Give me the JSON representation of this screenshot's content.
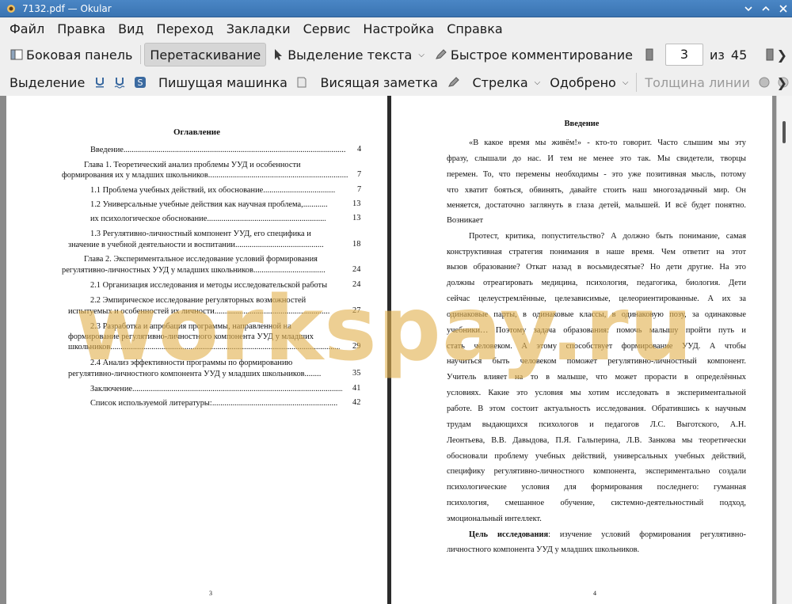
{
  "window": {
    "title": "7132.pdf  — Okular"
  },
  "menu": [
    "Файл",
    "Правка",
    "Вид",
    "Переход",
    "Закладки",
    "Сервис",
    "Настройка",
    "Справка"
  ],
  "toolbar1": {
    "sidebar": "Боковая панель",
    "drag": "Перетаскивание",
    "text_select": "Выделение текста",
    "quick_comment": "Быстрое комментирование",
    "page_current": "3",
    "page_of": "из",
    "page_total": "45"
  },
  "toolbar2": {
    "highlight": "Выделение",
    "typewriter": "Пишущая машинка",
    "pop_note": "Висящая заметка",
    "arrow": "Стрелка",
    "approved": "Одобрено",
    "line_width": "Толщина линии"
  },
  "left_page": {
    "title": "Оглавление",
    "toc": [
      {
        "text": "Введение",
        "page": "4"
      },
      {
        "text": "Глава 1. Теоретический анализ проблемы УУД и особенности",
        "page": ""
      },
      {
        "text": "формирования их у младших школьников",
        "page": "7"
      },
      {
        "text": "1.1 Проблема учебных действий, их обоснование",
        "page": "7"
      },
      {
        "text": "1.2 Универсальные учебные действия как научная проблема,",
        "page": "13"
      },
      {
        "text": "их психологическое обоснование",
        "page": "13"
      },
      {
        "text": "1.3 Регулятивно-личностный компонент УУД, его специфика и",
        "page": ""
      },
      {
        "text": "значение в учебной деятельности и воспитании",
        "page": "18"
      },
      {
        "text": "Глава 2. Экспериментальное исследование условий формирования",
        "page": ""
      },
      {
        "text": "регулятивно-личностных УУД у младших школьников",
        "page": "24"
      },
      {
        "text": "2.1 Организация исследования и методы исследовательской работы",
        "page": "24"
      },
      {
        "text": "2.2 Эмпирическое исследование регуляторных возможностей",
        "page": ""
      },
      {
        "text": "испытуемых и особенностей их личности",
        "page": "27"
      },
      {
        "text": "2.3 Разработка и апробация программы, направленной на",
        "page": ""
      },
      {
        "text": "формирование регулятивно-личностного компонента УУД у младших",
        "page": ""
      },
      {
        "text": "школьников",
        "page": "29"
      },
      {
        "text": "2.4 Анализ эффективности программы по формированию",
        "page": ""
      },
      {
        "text": "регулятивно-личностного компонента УУД у младших школьников",
        "page": "35"
      },
      {
        "text": "Заключение",
        "page": "41"
      },
      {
        "text": "Список используемой литературы:",
        "page": "42"
      }
    ],
    "page_number": "3"
  },
  "right_page": {
    "title": "Введение",
    "lines": [
      "«В какое время мы живём!» - кто-то говорит. Часто слышим мы эту",
      "фразу, слышали до нас. И тем не менее это так. Мы свидетели, творцы",
      "перемен. То, что перемены необходимы - это уже позитивная мысль, потому",
      "что хватит бояться, обвинять, давайте стоить наш многозадачный мир. Он",
      "меняется, достаточно заглянуть в глаза детей, малышей. И всё будет понятно.",
      "Возникает",
      "Протест, критика, попустительство? А должно быть понимание, самая",
      "конструктивная стратегия понимания в наше время. Чем ответит на этот",
      "вызов образование? Откат назад в восьмидесятые? Но дети другие. На это",
      "должны отреагировать медицина, психология, педагогика, биология. Дети",
      "сейчас целеустремлённые, целезависимые, целеориентированные. А их за",
      "одинаковые парты, в одинаковые классы, в одинаковую позу, за одинаковые",
      "учебники… Поэтому задача образования: помочь малышу пройти путь и",
      "стать человеком. А этому способствует формирование УУД. А чтобы",
      "научиться быть человеком поможет регулятивно-личностный компонент.",
      "Учитель влияет на то в малыше, что может прорасти в определённых",
      "условиях. Какие это условия мы хотим исследовать в экспериментальной",
      "работе. В этом состоит актуальность исследования. Обратившись к научным",
      "трудам выдающихся психологов и педагогов Л.С. Выготского, А.Н.",
      "Леонтьева, В.В. Давыдова, П.Я. Гальперина, Л.В. Занкова мы теоретически",
      "обосновали проблему учебных действий, универсальных учебных действий,",
      "специфику регулятивно-личностного компонента, экспериментально создали",
      "психологические условия для формирования последнего: гуманная",
      "психология, смешанное обучение, системно-деятельностный подход,",
      "эмоциональный интеллект."
    ],
    "goal_label": "Цель исследования",
    "goal_text_1": ": изучение условий формирования регулятивно-",
    "goal_text_2": "личностного компонента УУД у младших школьников.",
    "page_number": "4"
  },
  "watermark": "workspay.ru"
}
